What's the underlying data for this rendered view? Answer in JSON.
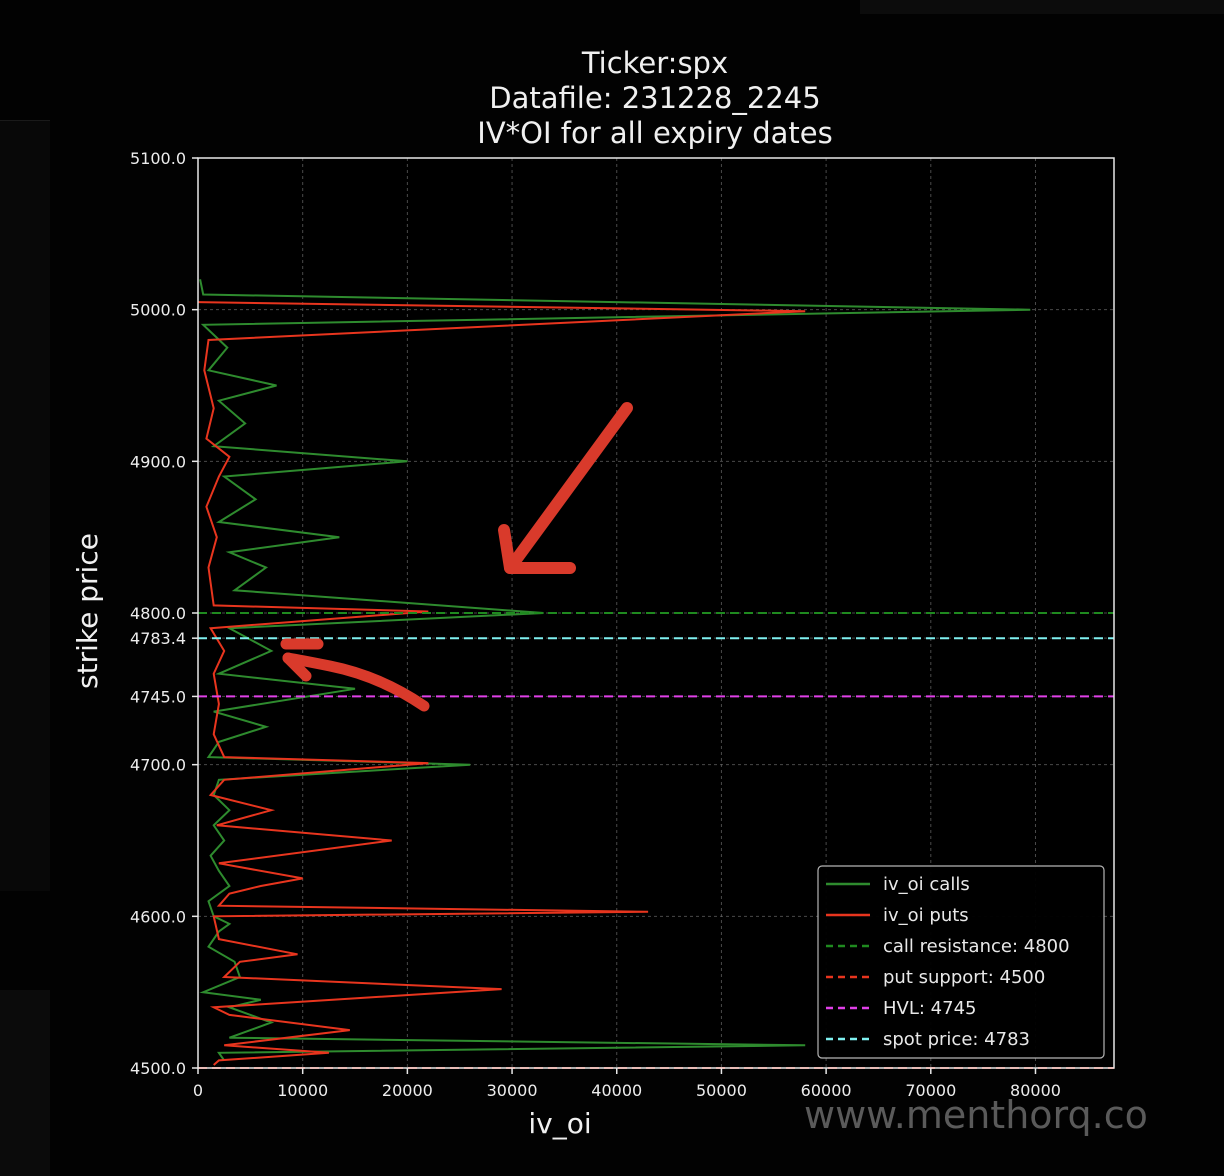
{
  "chart_data": {
    "type": "line",
    "title": "Ticker:spx",
    "subtitle_1": "Datafile: 231228_2245",
    "subtitle_2": "IV*OI for all expiry dates",
    "xlabel": "iv_oi",
    "ylabel": "strike price",
    "xlim": [
      0,
      87500
    ],
    "ylim": [
      4500,
      5100
    ],
    "x_ticks": [
      "0",
      "10000",
      "20000",
      "30000",
      "40000",
      "50000",
      "60000",
      "70000",
      "80000"
    ],
    "y_ticks": [
      "4500.0",
      "4600.0",
      "4700.0",
      "4745.0",
      "4783.4",
      "4800.0",
      "4900.0",
      "5000.0",
      "5100.0"
    ],
    "grid": true,
    "legend_position": "bottom-right",
    "series": [
      {
        "name": "iv_oi calls",
        "color": "#2e8b2e",
        "style": "solid",
        "points": [
          [
            2500,
            4505
          ],
          [
            2000,
            4510
          ],
          [
            58000,
            4515
          ],
          [
            3000,
            4520
          ],
          [
            7000,
            4530
          ],
          [
            3000,
            4540
          ],
          [
            6000,
            4545
          ],
          [
            500,
            4550
          ],
          [
            4000,
            4560
          ],
          [
            3500,
            4570
          ],
          [
            1000,
            4580
          ],
          [
            2000,
            4590
          ],
          [
            3000,
            4595
          ],
          [
            1500,
            4600
          ],
          [
            1000,
            4610
          ],
          [
            3000,
            4620
          ],
          [
            2000,
            4630
          ],
          [
            1200,
            4640
          ],
          [
            2500,
            4650
          ],
          [
            1500,
            4660
          ],
          [
            3000,
            4670
          ],
          [
            1500,
            4680
          ],
          [
            2000,
            4690
          ],
          [
            26000,
            4700
          ],
          [
            1000,
            4705
          ],
          [
            2000,
            4715
          ],
          [
            6500,
            4725
          ],
          [
            1500,
            4735
          ],
          [
            15000,
            4750
          ],
          [
            2000,
            4760
          ],
          [
            7000,
            4775
          ],
          [
            3000,
            4790
          ],
          [
            33000,
            4800
          ],
          [
            3500,
            4815
          ],
          [
            6500,
            4830
          ],
          [
            3000,
            4840
          ],
          [
            13500,
            4850
          ],
          [
            2000,
            4860
          ],
          [
            5500,
            4875
          ],
          [
            2500,
            4890
          ],
          [
            20000,
            4900
          ],
          [
            1500,
            4910
          ],
          [
            4500,
            4925
          ],
          [
            2000,
            4940
          ],
          [
            7500,
            4950
          ],
          [
            1000,
            4960
          ],
          [
            2800,
            4975
          ],
          [
            500,
            4990
          ],
          [
            79500,
            5000
          ],
          [
            500,
            5010
          ],
          [
            200,
            5020
          ]
        ]
      },
      {
        "name": "iv_oi puts",
        "color": "#e8351e",
        "style": "solid",
        "points": [
          [
            1500,
            4502
          ],
          [
            2000,
            4505
          ],
          [
            12500,
            4510
          ],
          [
            2500,
            4515
          ],
          [
            14500,
            4525
          ],
          [
            3000,
            4535
          ],
          [
            1500,
            4540
          ],
          [
            29000,
            4552
          ],
          [
            2500,
            4560
          ],
          [
            4000,
            4570
          ],
          [
            9500,
            4575
          ],
          [
            2000,
            4585
          ],
          [
            1500,
            4600
          ],
          [
            43000,
            4603
          ],
          [
            2000,
            4607
          ],
          [
            3000,
            4615
          ],
          [
            6000,
            4620
          ],
          [
            10000,
            4625
          ],
          [
            2000,
            4635
          ],
          [
            18500,
            4650
          ],
          [
            1800,
            4660
          ],
          [
            7000,
            4670
          ],
          [
            1200,
            4680
          ],
          [
            2500,
            4690
          ],
          [
            22000,
            4701
          ],
          [
            2500,
            4705
          ],
          [
            1500,
            4720
          ],
          [
            2000,
            4740
          ],
          [
            1500,
            4760
          ],
          [
            2500,
            4775
          ],
          [
            1200,
            4790
          ],
          [
            22000,
            4801
          ],
          [
            1500,
            4805
          ],
          [
            1000,
            4830
          ],
          [
            1800,
            4850
          ],
          [
            800,
            4870
          ],
          [
            2000,
            4890
          ],
          [
            3000,
            4903
          ],
          [
            800,
            4915
          ],
          [
            1500,
            4935
          ],
          [
            600,
            4960
          ],
          [
            1000,
            4980
          ],
          [
            58000,
            4999
          ],
          [
            0,
            5005
          ]
        ]
      },
      {
        "name": "call resistance: 4800",
        "color": "#1f8a1f",
        "style": "dashed",
        "points": [
          [
            0,
            4800
          ],
          [
            87500,
            4800
          ]
        ]
      },
      {
        "name": "put support: 4500",
        "color": "#e8351e",
        "style": "dashed",
        "points": [
          [
            0,
            4500
          ],
          [
            87500,
            4500
          ]
        ]
      },
      {
        "name": "HVL: 4745",
        "color": "#e040e8",
        "style": "dashed",
        "points": [
          [
            0,
            4745
          ],
          [
            87500,
            4745
          ]
        ]
      },
      {
        "name": "spot price: 4783",
        "color": "#7ff0f0",
        "style": "dashed",
        "points": [
          [
            0,
            4783.4
          ],
          [
            87500,
            4783.4
          ]
        ]
      }
    ],
    "annotations": {
      "watermark": "www.menthorq.co",
      "arrow_color": "#d93a2b"
    }
  }
}
